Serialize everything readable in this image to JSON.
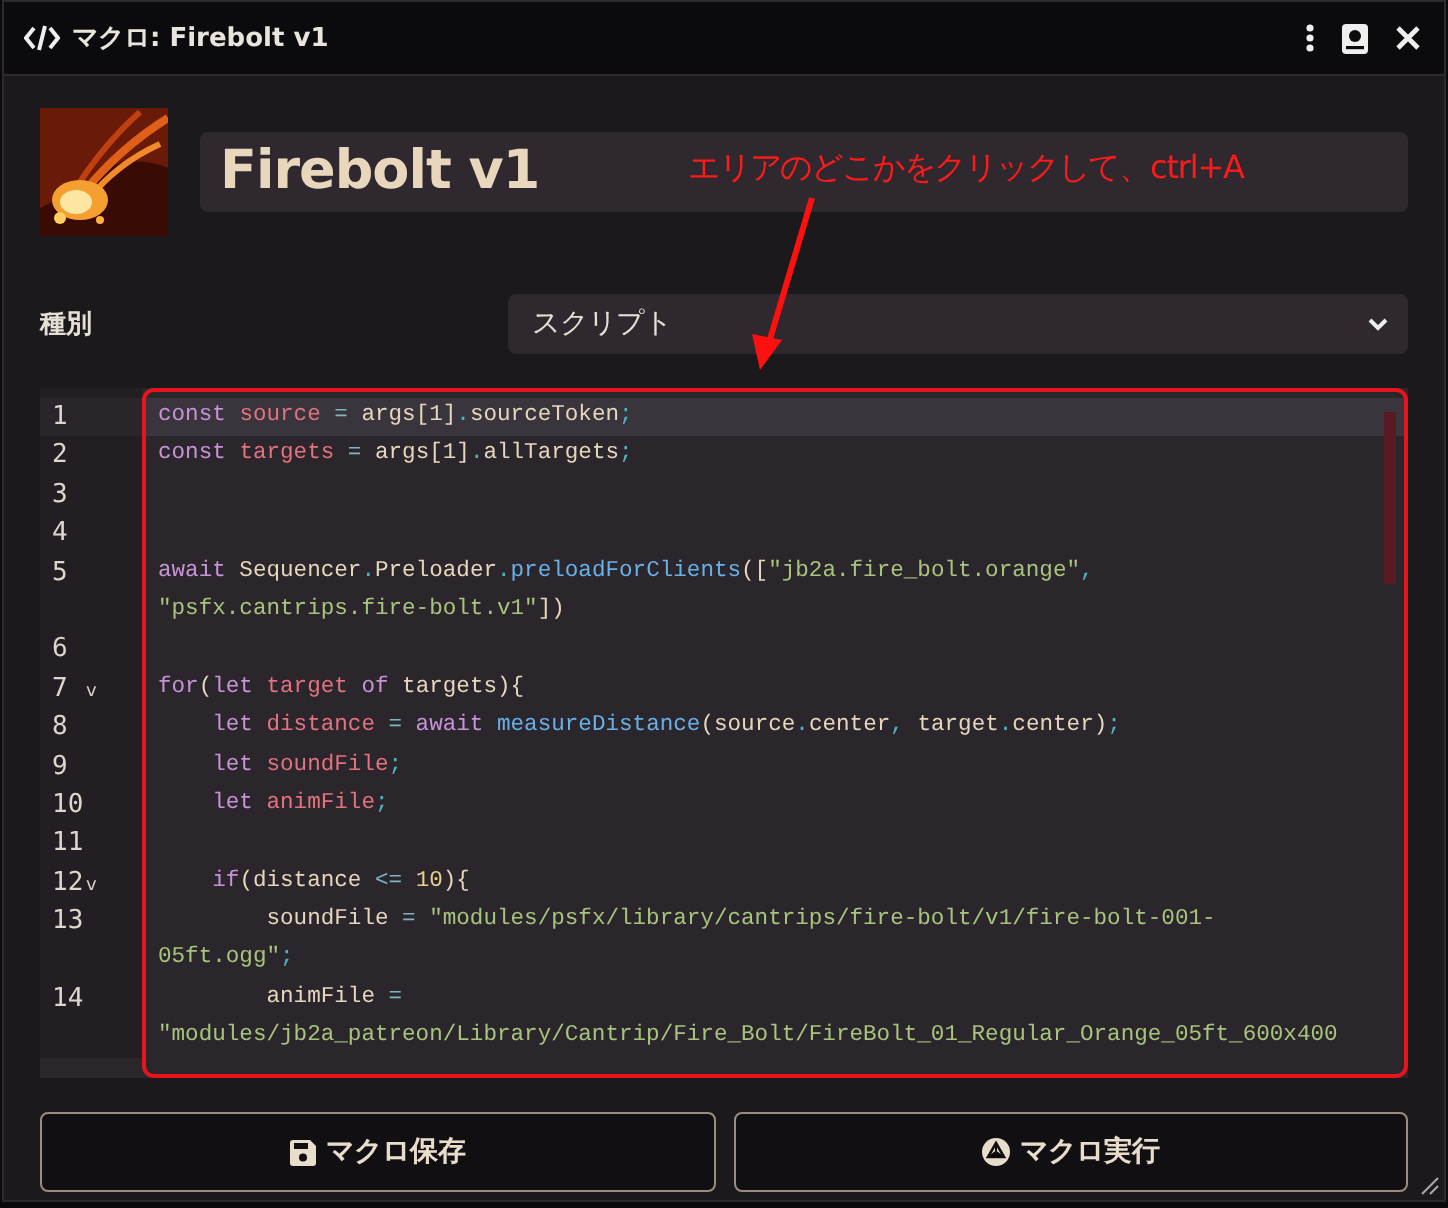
{
  "window": {
    "title": "マクロ: Firebolt v1"
  },
  "macro": {
    "name": "Firebolt v1"
  },
  "type_field": {
    "label": "種別",
    "value": "スクリプト"
  },
  "editor": {
    "lines": [
      {
        "number": "1",
        "active": true,
        "rows": [
          {
            "segments": [
              {
                "kind": "keyword",
                "text": "const "
              },
              {
                "kind": "def",
                "text": "source "
              },
              {
                "kind": "op",
                "text": "="
              },
              {
                "kind": "plain",
                "text": " args[1]"
              },
              {
                "kind": "punct",
                "text": "."
              },
              {
                "kind": "plain",
                "text": "sourceToken"
              },
              {
                "kind": "punct",
                "text": ";"
              }
            ]
          }
        ]
      },
      {
        "number": "2",
        "active": false,
        "rows": [
          {
            "segments": [
              {
                "kind": "keyword",
                "text": "const "
              },
              {
                "kind": "def",
                "text": "targets "
              },
              {
                "kind": "op",
                "text": "="
              },
              {
                "kind": "plain",
                "text": " args[1]"
              },
              {
                "kind": "punct",
                "text": "."
              },
              {
                "kind": "plain",
                "text": "allTargets"
              },
              {
                "kind": "punct",
                "text": ";"
              }
            ]
          }
        ]
      },
      {
        "number": "3",
        "active": false
      },
      {
        "number": "4",
        "active": false
      },
      {
        "number": "5",
        "active": false,
        "rows": [
          {
            "segments": [
              {
                "kind": "keyword",
                "text": "await"
              },
              {
                "kind": "plain",
                "text": " Sequencer"
              },
              {
                "kind": "punct",
                "text": "."
              },
              {
                "kind": "plain",
                "text": "Preloader"
              },
              {
                "kind": "punct",
                "text": "."
              },
              {
                "kind": "func",
                "text": "preloadForClients"
              },
              {
                "kind": "plain",
                "text": "(["
              },
              {
                "kind": "string",
                "text": "\"jb2a.fire_bolt.orange\""
              },
              {
                "kind": "punct",
                "text": ","
              }
            ]
          },
          {
            "segments": [
              {
                "kind": "string",
                "text": "\"psfx.cantrips.fire-bolt.v1\""
              },
              {
                "kind": "plain",
                "text": "])"
              }
            ]
          }
        ]
      },
      {
        "number": "6",
        "active": false
      },
      {
        "number": "7",
        "active": false,
        "fold_marker": "v",
        "rows": [
          {
            "segments": [
              {
                "kind": "keyword",
                "text": "for"
              },
              {
                "kind": "plain",
                "text": "("
              },
              {
                "kind": "keyword",
                "text": "let "
              },
              {
                "kind": "def",
                "text": "target "
              },
              {
                "kind": "keyword",
                "text": "of"
              },
              {
                "kind": "plain",
                "text": " targets){"
              }
            ]
          }
        ]
      },
      {
        "number": "8",
        "active": false,
        "rows": [
          {
            "segments": [
              {
                "kind": "keyword",
                "text": "    let "
              },
              {
                "kind": "def",
                "text": "distance "
              },
              {
                "kind": "op",
                "text": "="
              },
              {
                "kind": "keyword",
                "text": " await "
              },
              {
                "kind": "func",
                "text": "measureDistance"
              },
              {
                "kind": "plain",
                "text": "(source"
              },
              {
                "kind": "punct",
                "text": "."
              },
              {
                "kind": "plain",
                "text": "center"
              },
              {
                "kind": "punct",
                "text": ","
              },
              {
                "kind": "plain",
                "text": " target"
              },
              {
                "kind": "punct",
                "text": "."
              },
              {
                "kind": "plain",
                "text": "center)"
              },
              {
                "kind": "punct",
                "text": ";"
              }
            ]
          }
        ]
      },
      {
        "number": "9",
        "active": false,
        "rows": [
          {
            "segments": [
              {
                "kind": "keyword",
                "text": "    let "
              },
              {
                "kind": "def",
                "text": "soundFile"
              },
              {
                "kind": "punct",
                "text": ";"
              }
            ]
          }
        ]
      },
      {
        "number": "10",
        "active": false,
        "rows": [
          {
            "segments": [
              {
                "kind": "keyword",
                "text": "    let "
              },
              {
                "kind": "def",
                "text": "animFile"
              },
              {
                "kind": "punct",
                "text": ";"
              }
            ]
          }
        ]
      },
      {
        "number": "11",
        "active": false
      },
      {
        "number": "12",
        "active": false,
        "fold_marker": "v",
        "rows": [
          {
            "segments": [
              {
                "kind": "keyword",
                "text": "    if"
              },
              {
                "kind": "plain",
                "text": "(distance "
              },
              {
                "kind": "op",
                "text": "<="
              },
              {
                "kind": "number",
                "text": " 10"
              },
              {
                "kind": "plain",
                "text": "){"
              }
            ]
          }
        ]
      },
      {
        "number": "13",
        "active": false,
        "rows": [
          {
            "segments": [
              {
                "kind": "plain",
                "text": "        soundFile "
              },
              {
                "kind": "op",
                "text": "="
              },
              {
                "kind": "string",
                "text": " \"modules/psfx/library/cantrips/fire-bolt/v1/fire-bolt-001-"
              }
            ]
          },
          {
            "segments": [
              {
                "kind": "string",
                "text": "05ft.ogg\""
              },
              {
                "kind": "punct",
                "text": ";"
              }
            ]
          }
        ]
      },
      {
        "number": "14",
        "active": false,
        "rows": [
          {
            "segments": [
              {
                "kind": "plain",
                "text": "        animFile "
              },
              {
                "kind": "op",
                "text": "="
              }
            ]
          },
          {
            "segments": [
              {
                "kind": "string",
                "text": "\"modules/jb2a_patreon/Library/Cantrip/Fire_Bolt/FireBolt_01_Regular_Orange_05ft_600x400"
              }
            ]
          }
        ]
      }
    ]
  },
  "buttons": [
    {
      "kind": "save",
      "label": "マクロ保存"
    },
    {
      "kind": "execute",
      "label": "マクロ実行"
    }
  ],
  "annotation": {
    "text": "エリアのどこかをクリックして、ctrl+A"
  }
}
